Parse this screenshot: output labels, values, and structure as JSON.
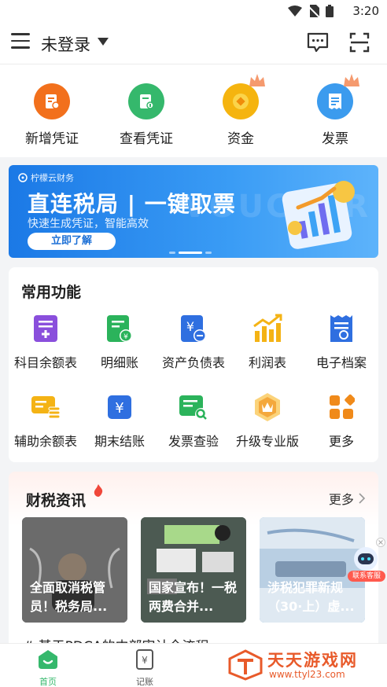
{
  "status_bar": {
    "time": "3:20"
  },
  "header": {
    "login_label": "未登录"
  },
  "quick_actions": [
    {
      "label": "新增凭证",
      "color": "#f2701c"
    },
    {
      "label": "查看凭证",
      "color": "#35b86c"
    },
    {
      "label": "资金",
      "color": "#f5b40f"
    },
    {
      "label": "发票",
      "color": "#3b9bee"
    }
  ],
  "banner": {
    "brand": "柠檬云财务",
    "title": "直连税局 | 一键取票",
    "subtitle": "快速生成凭证，智能高效",
    "button": "立即了解",
    "watermark": "VOUCHER"
  },
  "common_functions": {
    "title": "常用功能",
    "items": [
      {
        "label": "科目余额表",
        "icon": "ledger-plus-icon",
        "color": "#8a4fdc"
      },
      {
        "label": "明细账",
        "icon": "detail-ledger-icon",
        "color": "#2bb35b"
      },
      {
        "label": "资产负债表",
        "icon": "balance-sheet-icon",
        "color": "#2f6fe0"
      },
      {
        "label": "利润表",
        "icon": "profit-chart-icon",
        "color": "#f4b315"
      },
      {
        "label": "电子档案",
        "icon": "e-archive-icon",
        "color": "#2f6fe0"
      },
      {
        "label": "辅助余额表",
        "icon": "aux-balance-icon",
        "color": "#f4b315"
      },
      {
        "label": "期末结账",
        "icon": "period-close-icon",
        "color": "#2f6fe0"
      },
      {
        "label": "发票查验",
        "icon": "invoice-check-icon",
        "color": "#2bb35b"
      },
      {
        "label": "升级专业版",
        "icon": "upgrade-badge-icon",
        "color": "#f4a83c"
      },
      {
        "label": "更多",
        "icon": "more-grid-icon",
        "color": "#f08a1a"
      }
    ]
  },
  "news": {
    "title": "财税资讯",
    "more": "更多",
    "items": [
      {
        "caption": "全面取消税管员！税务局..."
      },
      {
        "caption": "国家宣布！一税两费合并..."
      },
      {
        "caption": "涉税犯罪新规（30·上）虚..."
      }
    ],
    "headline_partial": "# 基于PDCA的内部审计全流程"
  },
  "customer_service": {
    "label": "联系客服"
  },
  "tabs": [
    {
      "label": "首页",
      "active": true
    },
    {
      "label": "记账",
      "active": false
    }
  ],
  "watermark": {
    "name": "天天游戏网",
    "url": "www.ttyl23.com"
  }
}
